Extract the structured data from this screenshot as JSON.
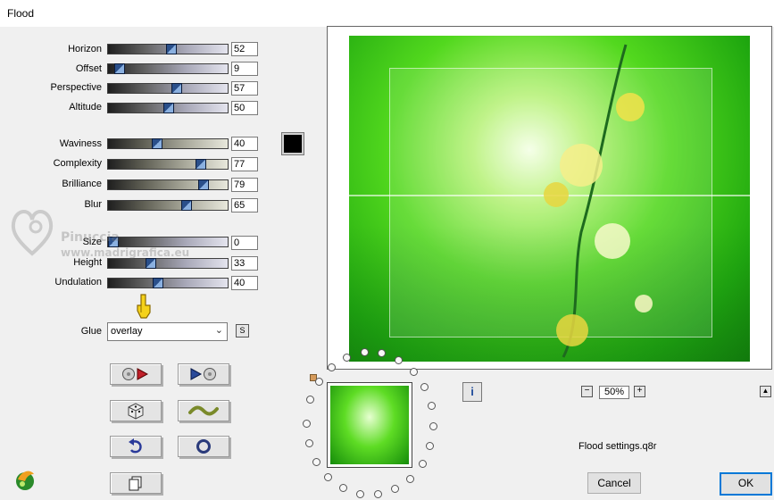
{
  "window": {
    "title": "Flood"
  },
  "params": [
    {
      "label": "Horizon",
      "value": "52",
      "pct": 52
    },
    {
      "label": "Offset",
      "value": "9",
      "pct": 9
    },
    {
      "label": "Perspective",
      "value": "57",
      "pct": 57
    },
    {
      "label": "Altitude",
      "value": "50",
      "pct": 50
    },
    {
      "label": "Waviness",
      "value": "40",
      "pct": 40
    },
    {
      "label": "Complexity",
      "value": "77",
      "pct": 77
    },
    {
      "label": "Brilliance",
      "value": "79",
      "pct": 79
    },
    {
      "label": "Blur",
      "value": "65",
      "pct": 65
    },
    {
      "label": "Size",
      "value": "0",
      "pct": 4
    },
    {
      "label": "Height",
      "value": "33",
      "pct": 35
    },
    {
      "label": "Undulation",
      "value": "40",
      "pct": 41
    }
  ],
  "color_swatch": "#000000",
  "glue": {
    "label": "Glue",
    "value": "overlay",
    "s_button": "S"
  },
  "zoom": {
    "value": "50%",
    "minus": "−",
    "plus": "+"
  },
  "info_label": "i",
  "up_label": "▲",
  "settings_file": "Flood settings.q8r",
  "buttons": {
    "cancel": "Cancel",
    "ok": "OK"
  },
  "watermark": {
    "line1": "Pinuccia",
    "line2": "www.madrigrafica.eu"
  },
  "colors": {
    "preview_green": "#3fd21a",
    "ok_border": "#0078d7"
  }
}
